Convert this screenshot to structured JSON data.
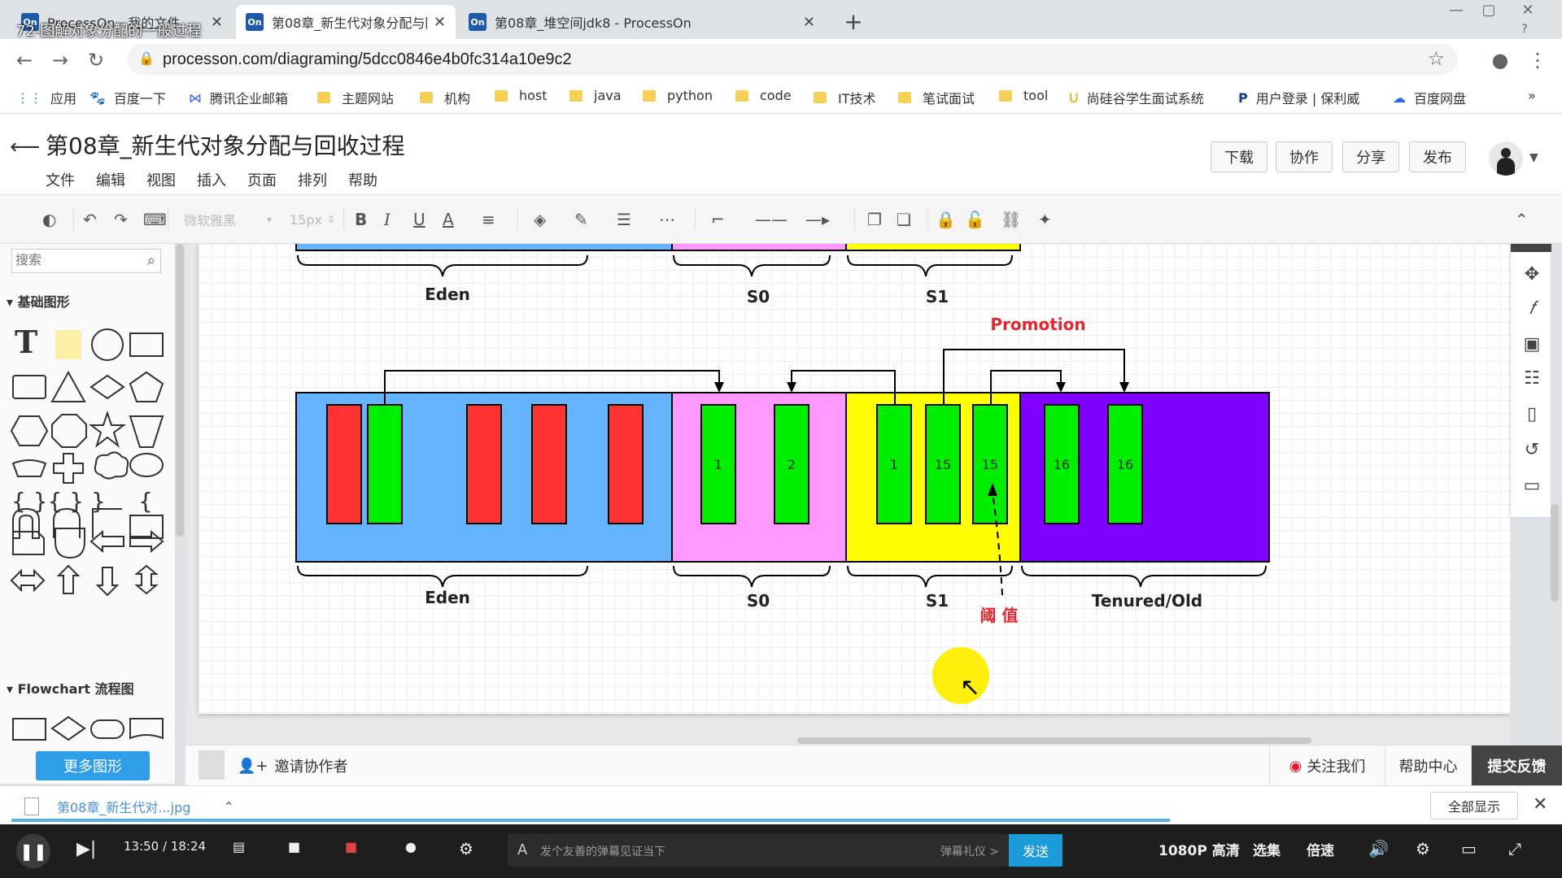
{
  "video_title": "72-图解对象分配的一般过程",
  "tabs": [
    {
      "label": "ProcessOn - 我的文件",
      "icon": "On"
    },
    {
      "label": "第08章_新生代对象分配与回收过",
      "icon": "On"
    },
    {
      "label": "第08章_堆空间jdk8 - ProcessOn",
      "icon": "On"
    }
  ],
  "address": {
    "url": "processon.com/diagraming/5dcc0846e4b0fc314a10e9c2"
  },
  "bookmarks": [
    "应用",
    "百度一下",
    "腾讯企业邮箱",
    "主题网站",
    "机构",
    "host",
    "java",
    "python",
    "code",
    "IT技术",
    "笔试面试",
    "tool",
    "尚硅谷学生面试系统",
    "用户登录 | 保利威",
    "百度网盘"
  ],
  "app": {
    "title": "第08章_新生代对象分配与回收过程",
    "menu": [
      "文件",
      "编辑",
      "视图",
      "插入",
      "页面",
      "排列",
      "帮助"
    ],
    "buttons": {
      "download": "下载",
      "collab": "协作",
      "share": "分享",
      "publish": "发布"
    }
  },
  "toolbar": {
    "font": "微软雅黑",
    "size": "15px"
  },
  "left_panel": {
    "search_placeholder": "搜索",
    "section_basic": "基础图形",
    "section_flowchart": "Flowchart 流程图",
    "more_shapes": "更多图形"
  },
  "diagram": {
    "top_labels": [
      "Eden",
      "S0",
      "S1"
    ],
    "bottom_labels": [
      "Eden",
      "S0",
      "S1",
      "Tenured/Old"
    ],
    "promotion": "Promotion",
    "threshold": "阈 值",
    "s0_boxes": [
      "1",
      "2"
    ],
    "s1_boxes": [
      "1",
      "15",
      "15"
    ],
    "old_boxes": [
      "16",
      "16"
    ],
    "colors": {
      "eden": "#66b3ff",
      "s0": "#ff99ff",
      "s1": "#ffff00",
      "old": "#7f00ff",
      "red": "#ff3333",
      "green": "#00ee00",
      "accent": "#e3262f"
    }
  },
  "bottombar": {
    "invite": "邀请协作者",
    "follow": "关注我们",
    "help": "帮助中心",
    "feedback": "提交反馈"
  },
  "download": {
    "file": "第08章_新生代对...jpg",
    "show_all": "全部显示"
  },
  "player": {
    "time": "13:50 / 18:24",
    "danmu_placeholder": "发个友善的弹幕见证当下",
    "danmu_etiquette": "弹幕礼仪 >",
    "send": "发送",
    "quality": "1080P 高清",
    "episodes": "选集",
    "speed": "倍速"
  }
}
